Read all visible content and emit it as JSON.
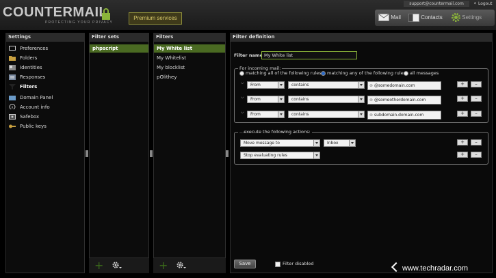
{
  "header": {
    "logo": "COUNTERMAIL",
    "tagline": "PROTECTING YOUR PRIVACY",
    "premium": "Premium services",
    "support_email": "support@countermail.com",
    "logout": "Logout",
    "nav": [
      {
        "label": "Mail",
        "icon": "envelope-icon"
      },
      {
        "label": "Contacts",
        "icon": "address-book-icon"
      },
      {
        "label": "Settings",
        "icon": "gear-icon"
      }
    ]
  },
  "settings": {
    "title": "Settings",
    "items": [
      {
        "label": "Preferences",
        "icon": "monitor-icon"
      },
      {
        "label": "Folders",
        "icon": "folder-icon"
      },
      {
        "label": "Identities",
        "icon": "identities-icon"
      },
      {
        "label": "Responses",
        "icon": "responses-icon"
      },
      {
        "label": "Filters",
        "icon": "filter-icon"
      },
      {
        "label": "Domain Panel",
        "icon": "domain-icon"
      },
      {
        "label": "Account info",
        "icon": "info-icon"
      },
      {
        "label": "Safebox",
        "icon": "safebox-icon"
      },
      {
        "label": "Public keys",
        "icon": "key-icon"
      }
    ],
    "selected_index": 4
  },
  "filter_sets": {
    "title": "Filter sets",
    "items": [
      "phpscript"
    ]
  },
  "filters": {
    "title": "Filters",
    "items": [
      "My White list",
      "My Whitelist",
      "My blocklist",
      "pOlithey"
    ]
  },
  "definition": {
    "title": "Filter definition",
    "name_label": "Filter name:",
    "name_value": "My White list",
    "incoming_legend": "For incoming mail:",
    "radios": [
      "matching all of the following rules",
      "matching any of the following rules",
      "all messages"
    ],
    "radio_selected": 1,
    "rules": [
      {
        "field": "From",
        "op": "contains",
        "value": "@somedomain.com"
      },
      {
        "field": "From",
        "op": "contains",
        "value": "@someotherdomain.com"
      },
      {
        "field": "From",
        "op": "contains",
        "value": "subdomain.domain.com"
      }
    ],
    "actions_legend": "...execute the following actions:",
    "actions": [
      {
        "action": "Move message to",
        "target": "Inbox"
      },
      {
        "action": "Stop evaluating rules",
        "target": ""
      }
    ],
    "plus": "+",
    "minus": "–",
    "save": "Save",
    "disabled_label": "Filter disabled"
  },
  "watermark": "www.techradar.com"
}
